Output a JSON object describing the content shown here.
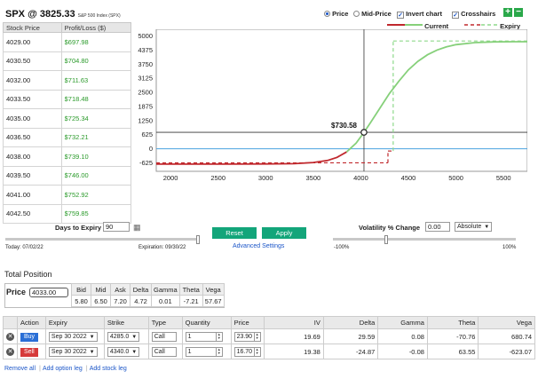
{
  "header": {
    "symbol_price": "SPX @ 3825.33",
    "subtitle": "S&P 500 Index (SPX)"
  },
  "price_table": {
    "col_price": "Stock Price",
    "col_pl": "Profit/Loss ($)",
    "rows": [
      {
        "price": "4029.00",
        "pl": "$697.98"
      },
      {
        "price": "4030.50",
        "pl": "$704.80"
      },
      {
        "price": "4032.00",
        "pl": "$711.63"
      },
      {
        "price": "4033.50",
        "pl": "$718.48"
      },
      {
        "price": "4035.00",
        "pl": "$725.34"
      },
      {
        "price": "4036.50",
        "pl": "$732.21"
      },
      {
        "price": "4038.00",
        "pl": "$739.10"
      },
      {
        "price": "4039.50",
        "pl": "$746.00"
      },
      {
        "price": "4041.00",
        "pl": "$752.92"
      },
      {
        "price": "4042.50",
        "pl": "$759.85"
      }
    ]
  },
  "controls": {
    "price_label": "Price",
    "mid_price_label": "Mid-Price",
    "invert_chart_label": "Invert chart",
    "crosshairs_label": "Crosshairs",
    "plus": "+",
    "minus": "−"
  },
  "legend": {
    "current": "Current",
    "expiry": "Expiry"
  },
  "colors": {
    "current_loss": "#c0282d",
    "current_profit": "#86d07a",
    "expiry": "#8ed98a",
    "zero_line": "#4aa3df",
    "button_green": "#13a57a"
  },
  "chart_data": {
    "type": "line",
    "xlim": [
      1850,
      5750
    ],
    "ylim": [
      -1000,
      5300
    ],
    "x_ticks": [
      2000,
      2500,
      3000,
      3500,
      4000,
      4500,
      5000,
      5500
    ],
    "y_ticks": [
      5000,
      4375,
      3750,
      3125,
      2500,
      1875,
      1250,
      625,
      0,
      -625
    ],
    "crosshair": {
      "x": 4033,
      "y": 730.58,
      "label": "$730.58"
    },
    "series": [
      {
        "name": "Current",
        "x": [
          1850,
          2500,
          3000,
          3300,
          3500,
          3650,
          3750,
          3850,
          3950,
          4033,
          4100,
          4200,
          4300,
          4400,
          4500,
          4600,
          4700,
          4800,
          4900,
          5000,
          5200,
          5400,
          5600,
          5750
        ],
        "y": [
          -680,
          -680,
          -675,
          -660,
          -610,
          -520,
          -380,
          -140,
          250,
          730,
          1150,
          1800,
          2450,
          3000,
          3500,
          3880,
          4170,
          4380,
          4520,
          4620,
          4710,
          4740,
          4750,
          4750
        ]
      },
      {
        "name": "Expiry",
        "x": [
          1850,
          4285,
          4285,
          4340,
          4340,
          5750
        ],
        "y": [
          -623,
          -623,
          -100,
          -100,
          4780,
          4780
        ]
      }
    ]
  },
  "days": {
    "label": "Days to Expiry",
    "value": "90",
    "today": "Today: 07/02/22",
    "expiration": "Expiration: 09/30/22",
    "slider_fraction": 1.0
  },
  "buttons": {
    "reset": "Reset",
    "apply": "Apply",
    "advanced": "Advanced Settings"
  },
  "volatility": {
    "label": "Volatility % Change",
    "value": "0.00",
    "mode": "Absolute",
    "min": "-100%",
    "max": "100%",
    "slider_fraction": 0.29
  },
  "total_position": {
    "title": "Total Position",
    "price_label": "Price",
    "price_value": "4033.00",
    "headers": [
      "Bid",
      "Mid",
      "Ask",
      "Delta",
      "Gamma",
      "Theta",
      "Vega"
    ],
    "values": [
      "5.80",
      "6.50",
      "7.20",
      "4.72",
      "0.01",
      "-7.21",
      "57.67"
    ]
  },
  "legs": {
    "headers": [
      "Action",
      "Expiry",
      "Strike",
      "Type",
      "Quantity",
      "Price",
      "IV",
      "Delta",
      "Gamma",
      "Theta",
      "Vega"
    ],
    "rows": [
      {
        "action": "Buy",
        "expiry": "Sep 30 2022",
        "strike": "4285.0",
        "type": "Call",
        "qty": "1",
        "price": "23.90",
        "iv": "19.69",
        "delta": "29.59",
        "gamma": "0.08",
        "theta": "-70.76",
        "vega": "680.74"
      },
      {
        "action": "Sell",
        "expiry": "Sep 30 2022",
        "strike": "4340.0",
        "type": "Call",
        "qty": "1",
        "price": "16.70",
        "iv": "19.38",
        "delta": "-24.87",
        "gamma": "-0.08",
        "theta": "63.55",
        "vega": "-623.07"
      }
    ]
  },
  "bottom_links": {
    "remove_all": "Remove all",
    "add_option": "Add option leg",
    "add_stock": "Add stock leg"
  }
}
